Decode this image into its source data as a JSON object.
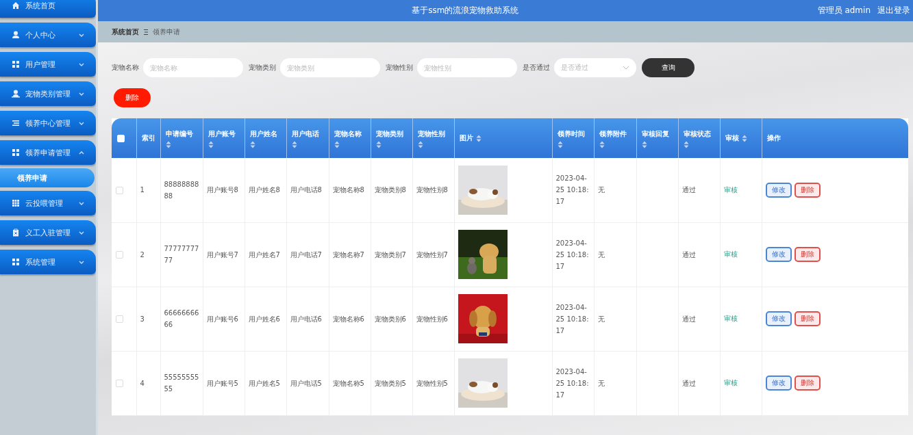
{
  "header": {
    "title": "基于ssm的流浪宠物救助系统",
    "user": "管理员 admin",
    "logout": "退出登录"
  },
  "sidebar": {
    "items": [
      {
        "label": "系统首页",
        "kind": "link"
      },
      {
        "label": "个人中心",
        "kind": "menu",
        "expanded": false
      },
      {
        "label": "用户管理",
        "kind": "menu",
        "expanded": false
      },
      {
        "label": "宠物类别管理",
        "kind": "menu",
        "expanded": false
      },
      {
        "label": "领养中心管理",
        "kind": "menu",
        "expanded": false
      },
      {
        "label": "领养申请管理",
        "kind": "menu",
        "expanded": true,
        "children": [
          {
            "label": "领养申请",
            "selected": true
          }
        ]
      },
      {
        "label": "云投喂管理",
        "kind": "menu",
        "expanded": false
      },
      {
        "label": "义工入驻管理",
        "kind": "menu",
        "expanded": false
      },
      {
        "label": "系统管理",
        "kind": "menu",
        "expanded": false
      }
    ]
  },
  "breadcrumb": [
    "系统首页",
    "领养申请"
  ],
  "search": {
    "fields": [
      {
        "label": "宠物名称",
        "placeholder": "宠物名称",
        "kind": "input"
      },
      {
        "label": "宠物类别",
        "placeholder": "宠物类别",
        "kind": "input"
      },
      {
        "label": "宠物性别",
        "placeholder": "宠物性别",
        "kind": "input"
      },
      {
        "label": "是否通过",
        "placeholder": "是否通过",
        "kind": "select"
      }
    ],
    "button": "查询"
  },
  "delete_button": "删除",
  "table": {
    "select_all": {
      "checked": false
    },
    "columns": [
      {
        "label": "索引",
        "sortable": false
      },
      {
        "label": "申请编号",
        "sortable": true
      },
      {
        "label": "用户账号",
        "sortable": true
      },
      {
        "label": "用户姓名",
        "sortable": true
      },
      {
        "label": "用户电话",
        "sortable": true
      },
      {
        "label": "宠物名称",
        "sortable": true
      },
      {
        "label": "宠物类别",
        "sortable": true
      },
      {
        "label": "宠物性别",
        "sortable": true
      },
      {
        "label": "图片",
        "sortable": true
      },
      {
        "label": "领养时间",
        "sortable": true
      },
      {
        "label": "领养附件",
        "sortable": true
      },
      {
        "label": "审核回复",
        "sortable": true
      },
      {
        "label": "审核状态",
        "sortable": true
      },
      {
        "label": "审核",
        "sortable": true
      },
      {
        "label": "操作",
        "sortable": false
      }
    ],
    "rows": [
      {
        "checked": false,
        "cells": [
          "1",
          "8888888888",
          "用户账号8",
          "用户姓名8",
          "用户电话8",
          "宠物名称8",
          "宠物类别8",
          "宠物性别8"
        ],
        "photo": {
          "kind": "picture"
        },
        "time": "2023-04-25 10:18:17",
        "attachment": "无",
        "status": "通过",
        "review": "审核",
        "actions": [
          "修改",
          "删除"
        ]
      },
      {
        "checked": false,
        "cells": [
          "2",
          "7777777777",
          "用户账号7",
          "用户姓名7",
          "用户电话7",
          "宠物名称7",
          "宠物类别7",
          "宠物性别7"
        ],
        "photo": {
          "kind": "picture"
        },
        "time": "2023-04-25 10:18:17",
        "attachment": "无",
        "status": "通过",
        "review": "审核",
        "actions": [
          "修改",
          "删除"
        ]
      },
      {
        "checked": false,
        "cells": [
          "3",
          "6666666666",
          "用户账号6",
          "用户姓名6",
          "用户电话6",
          "宠物名称6",
          "宠物类别6",
          "宠物性别6"
        ],
        "photo": {
          "kind": "picture"
        },
        "time": "2023-04-25 10:18:17",
        "attachment": "无",
        "status": "通过",
        "review": "审核",
        "actions": [
          "修改",
          "删除"
        ]
      },
      {
        "checked": false,
        "cells": [
          "4",
          "5555555555",
          "用户账号5",
          "用户姓名5",
          "用户电话5",
          "宠物名称5",
          "宠物类别5",
          "宠物性别5"
        ],
        "photo": {
          "kind": "picture"
        },
        "time": "2023-04-25 10:18:17",
        "attachment": "无",
        "status": "通过",
        "review": "审核",
        "actions": [
          "修改",
          "删除"
        ]
      }
    ]
  }
}
